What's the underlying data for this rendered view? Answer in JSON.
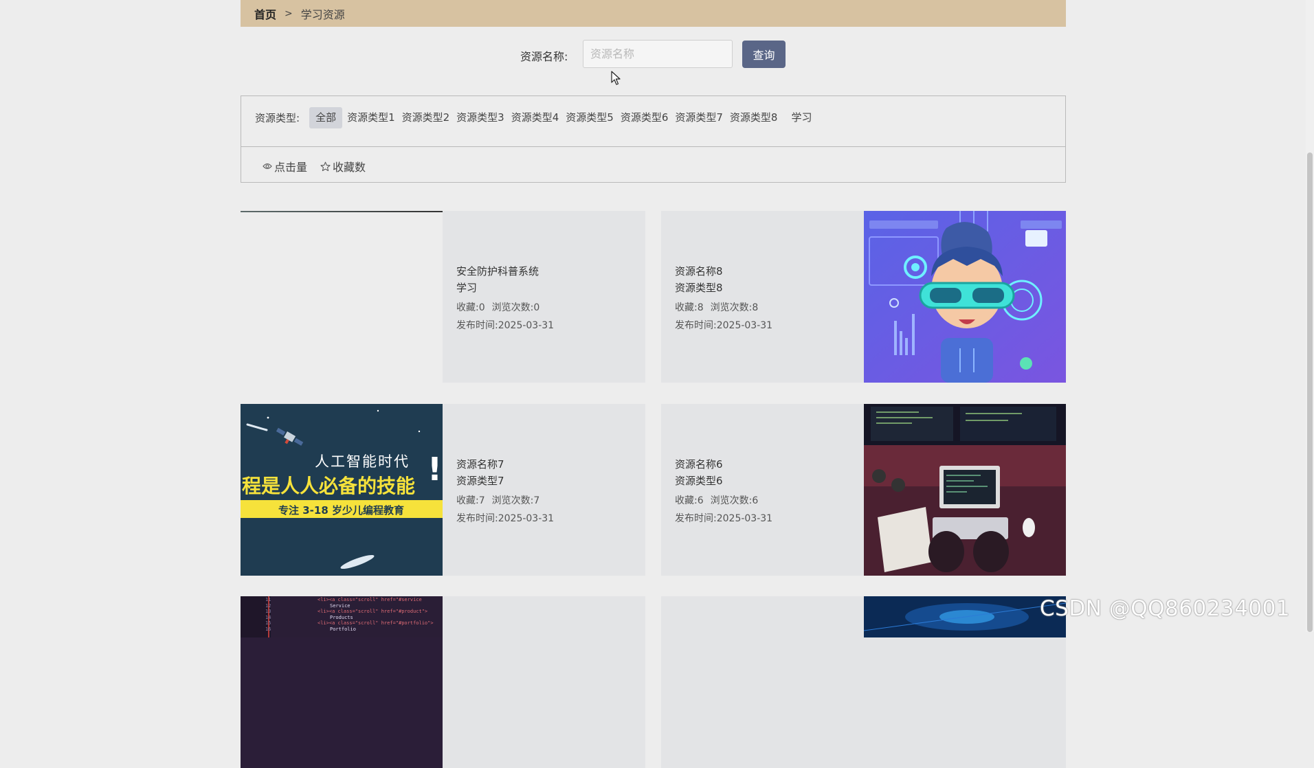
{
  "breadcrumb": {
    "home": "首页",
    "separator": ">",
    "current": "学习资源"
  },
  "search": {
    "label": "资源名称:",
    "placeholder": "资源名称",
    "value": "",
    "button": "查询"
  },
  "filters": {
    "type_label": "资源类型:",
    "types": [
      "全部",
      "资源类型1",
      "资源类型2",
      "资源类型3",
      "资源类型4",
      "资源类型5",
      "资源类型6",
      "资源类型7",
      "资源类型8",
      "学习"
    ],
    "active_type": "全部",
    "sort": [
      {
        "label": "点击量",
        "icon": "eye-icon"
      },
      {
        "label": "收藏数",
        "icon": "star-icon"
      }
    ]
  },
  "labels": {
    "fav": "收藏:",
    "views": "浏览次数:",
    "published": "发布时间:"
  },
  "resources": [
    {
      "name": "安全防护科普系统",
      "type": "学习",
      "fav": "0",
      "views": "0",
      "date": "2025-03-31",
      "image": "blank-image"
    },
    {
      "name": "资源名称8",
      "type": "资源类型8",
      "fav": "8",
      "views": "8",
      "date": "2025-03-31",
      "image": "vr-kid-illustration"
    },
    {
      "name": "资源名称7",
      "type": "资源类型7",
      "fav": "7",
      "views": "7",
      "date": "2025-03-31",
      "image": "ai-programming-banner"
    },
    {
      "name": "资源名称6",
      "type": "资源类型6",
      "fav": "6",
      "views": "6",
      "date": "2025-03-31",
      "image": "coding-desk-photo"
    },
    {
      "image": "code-editor-screenshot"
    },
    {
      "image": "tech-blue-banner"
    }
  ],
  "banner_text": {
    "line1": "人工智能时代",
    "line2": "程是人人必备的技能",
    "exclaim": "!",
    "line3": "专注 3-18 岁少儿编程教育"
  },
  "code_lines": {
    "nums": [
      "11",
      "12",
      "13",
      "14",
      "15",
      "16"
    ],
    "lines": [
      "<li><a class=\"scroll\" href=\"#service",
      "Service",
      "<li><a class=\"scroll\" href=\"#product\">",
      "Products",
      "<li><a class=\"scroll\" href=\"#portfolio\">",
      "Portfolio"
    ]
  },
  "watermark": "CSDN @QQ860234001",
  "colors": {
    "breadcrumb_bg": "#d7c2a1",
    "button_bg": "#5a6687",
    "card_bg": "#e3e4e6",
    "page_bg": "#ededed"
  }
}
